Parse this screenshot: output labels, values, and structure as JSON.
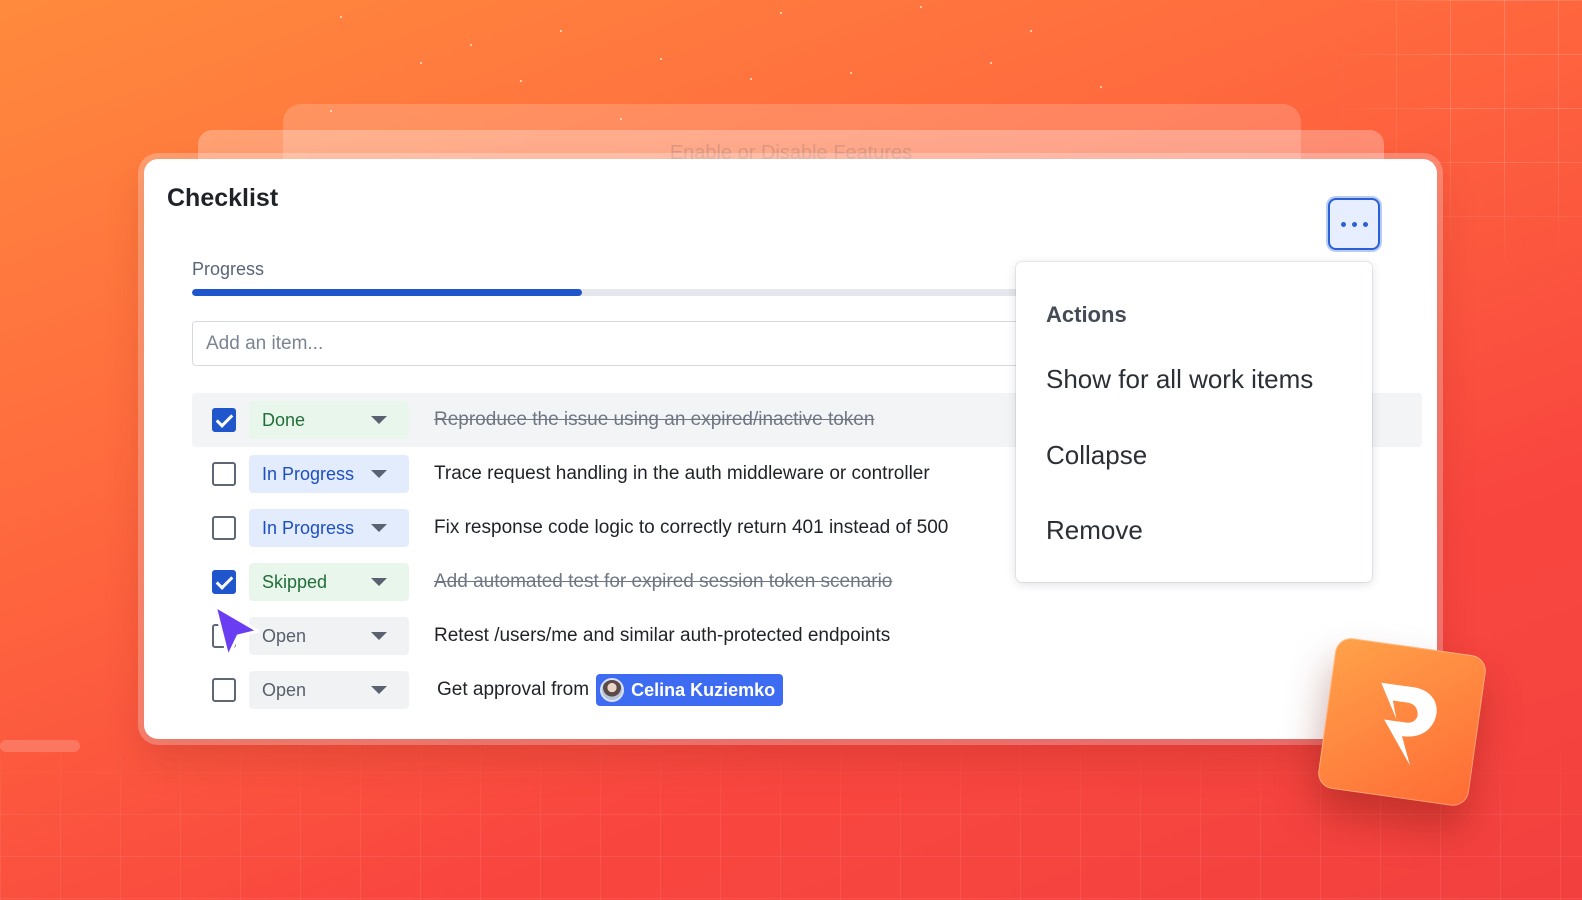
{
  "background_ghosts": {
    "ghost_title": "Enable or Disable Features"
  },
  "checklist": {
    "title": "Checklist",
    "progress_label": "Progress",
    "progress_fraction": 0.47,
    "add_item_placeholder": "Add an item...",
    "items": [
      {
        "checked": true,
        "status": "Done",
        "status_style": "done",
        "text": "Reproduce the issue using an expired/inactive token",
        "struck": true
      },
      {
        "checked": false,
        "status": "In Progress",
        "status_style": "progress",
        "text": "Trace request handling in the auth middleware or controller",
        "struck": false
      },
      {
        "checked": false,
        "status": "In Progress",
        "status_style": "progress",
        "text": "Fix response code logic to correctly return 401 instead of 500",
        "struck": false
      },
      {
        "checked": true,
        "status": "Skipped",
        "status_style": "skipped",
        "text": "Add automated test for expired session token scenario",
        "struck": true
      },
      {
        "checked": false,
        "status": "Open",
        "status_style": "open",
        "text": "Retest /users/me and similar auth-protected endpoints",
        "struck": false
      },
      {
        "checked": false,
        "status": "Open",
        "status_style": "open",
        "text": "Get approval from",
        "mention": "Celina Kuziemko",
        "struck": false
      }
    ]
  },
  "actions_menu": {
    "heading": "Actions",
    "items": [
      "Show for all work items",
      "Collapse",
      "Remove"
    ]
  },
  "colors": {
    "accent": "#1f56cc",
    "mention": "#3d6cf2",
    "done_bg": "#e8f6ec",
    "progress_bg": "#e3ecfd",
    "cursor": "#6b3df2"
  },
  "icons": {
    "more": "more-horizontal-icon",
    "cursor": "pointer-cursor-icon",
    "logo": "brand-logo-icon"
  }
}
